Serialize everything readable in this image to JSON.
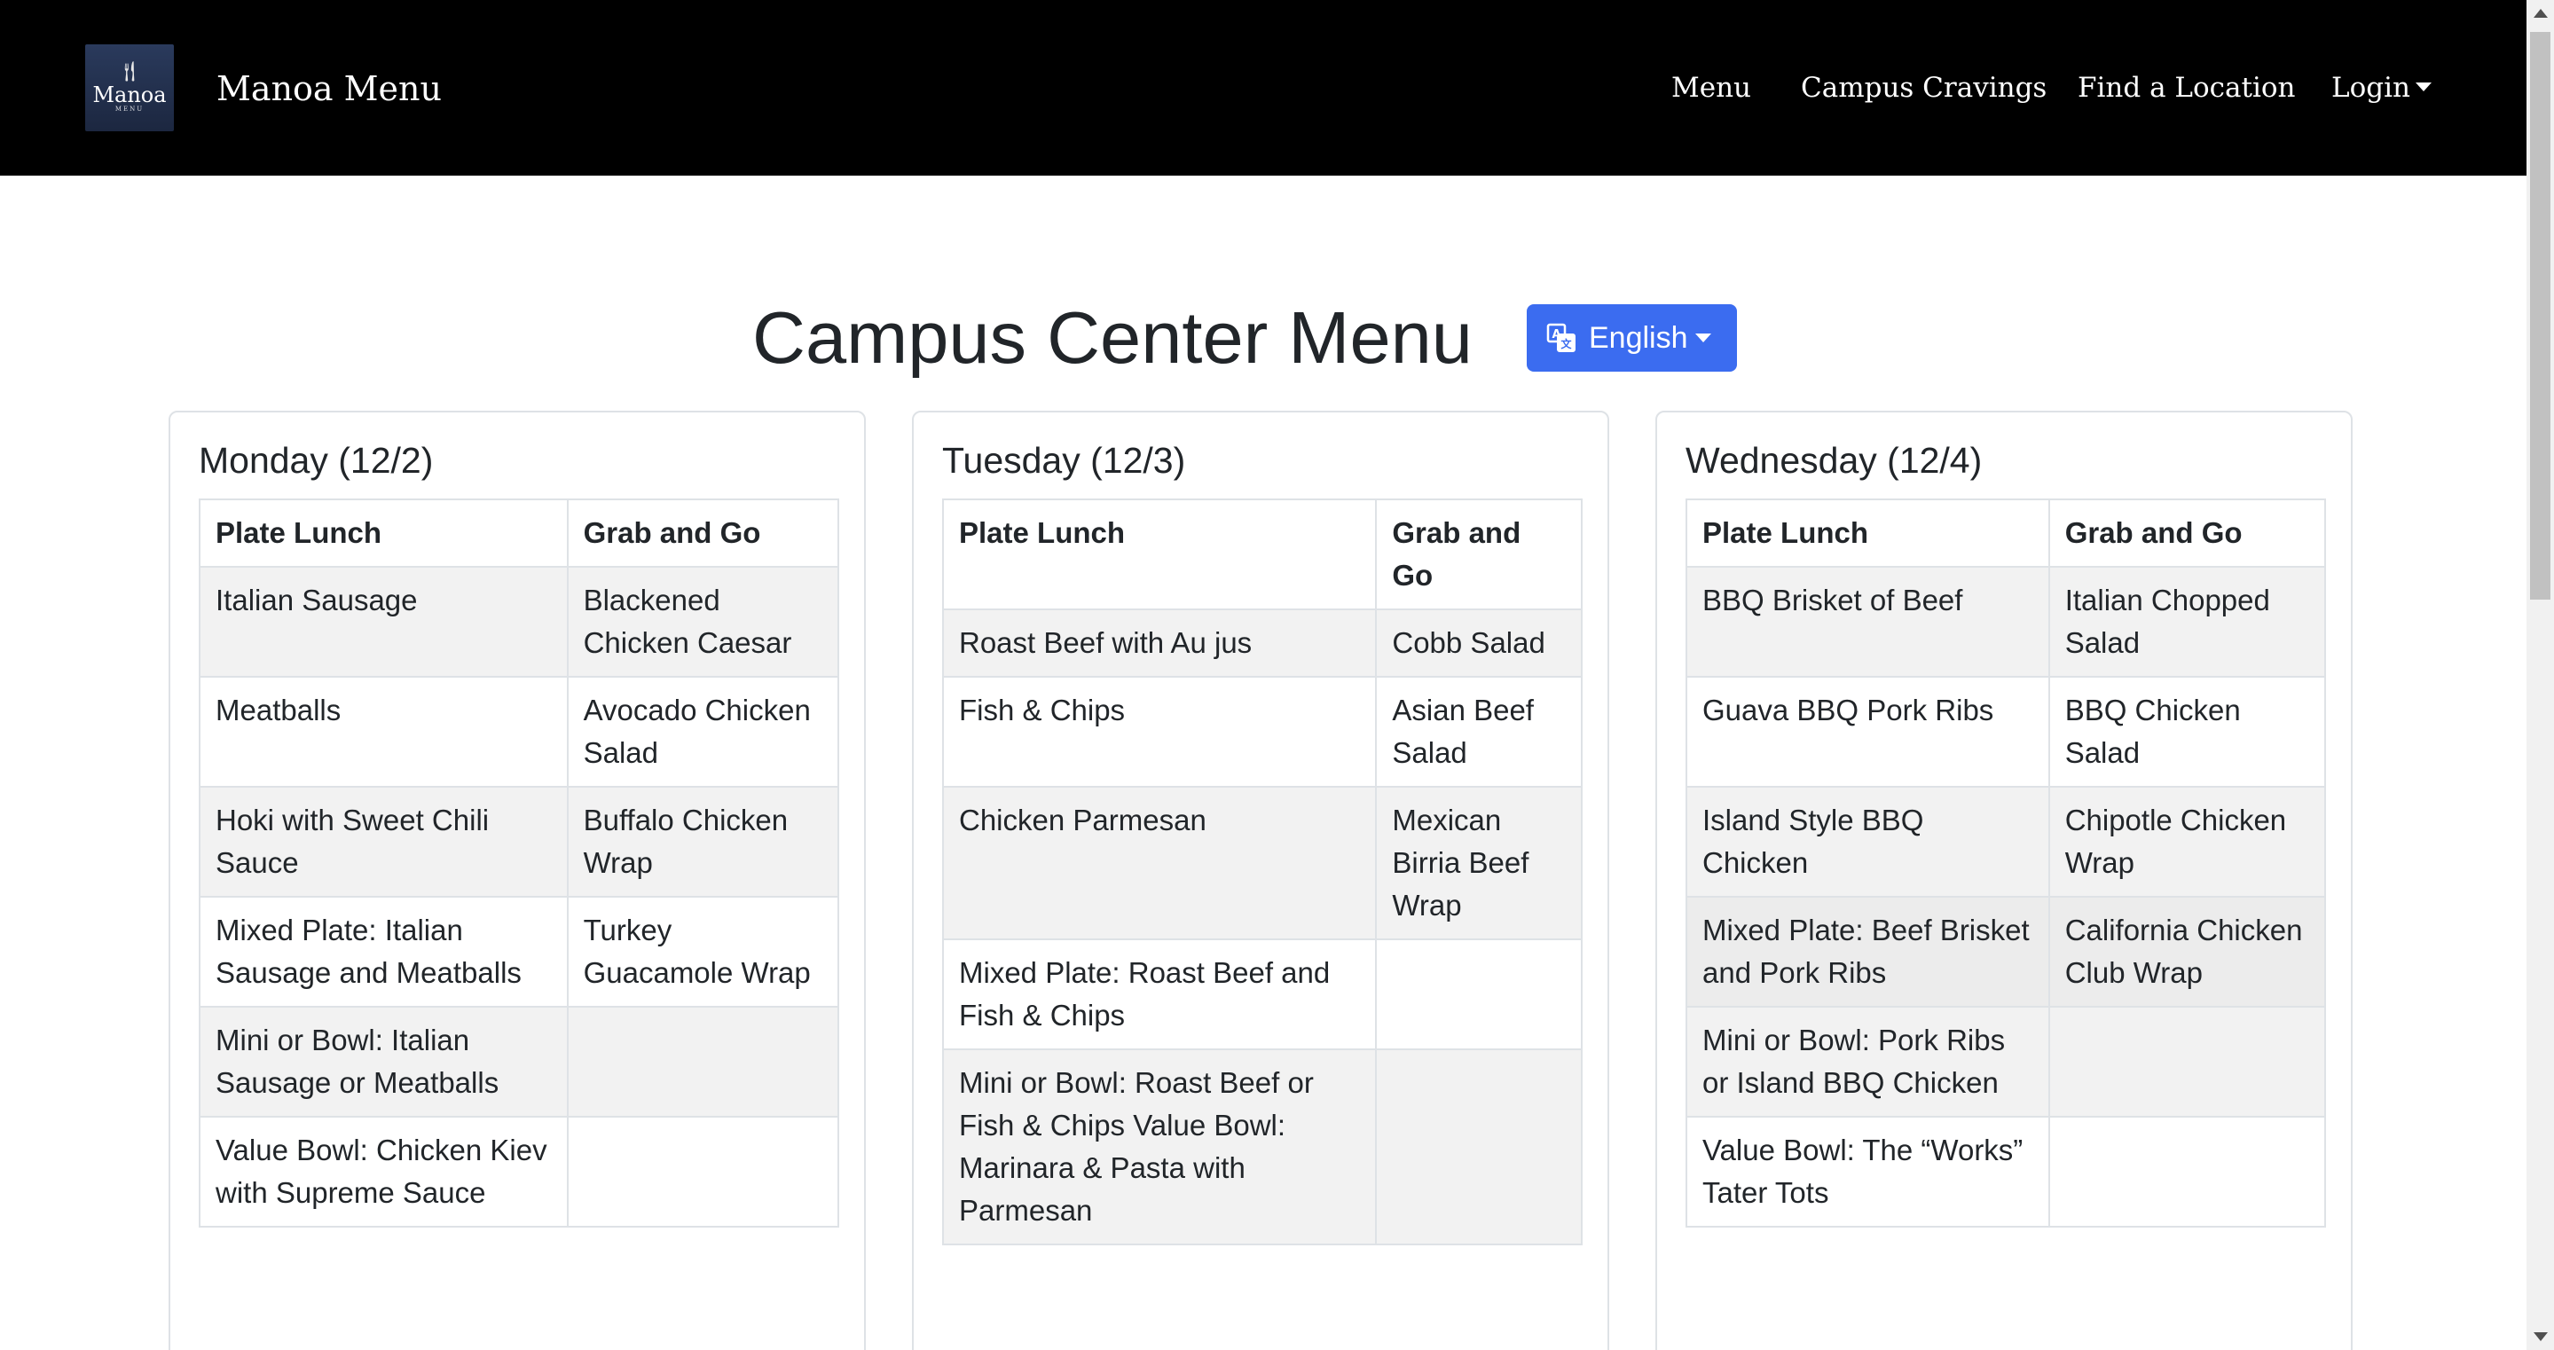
{
  "navbar": {
    "logo": {
      "word": "Manoa",
      "sub": "MENU"
    },
    "brand": "Manoa Menu",
    "links": [
      "Menu",
      "Campus Cravings",
      "Find a Location"
    ],
    "login": "Login"
  },
  "icons": {
    "logo": "fork-knife-icon",
    "language": "translate-icon",
    "dropdown": "caret-down-icon"
  },
  "colors": {
    "navbar_bg": "#000000",
    "accent": "#3b6cf0",
    "stripe": "#f2f2f2",
    "border": "#dee2e6"
  },
  "page": {
    "title": "Campus Center Menu",
    "language": "English"
  },
  "days": [
    {
      "title": "Monday (12/2)",
      "headers": [
        "Plate Lunch",
        "Grab and Go"
      ],
      "rows": [
        [
          "Italian Sausage",
          "Blackened Chicken Caesar"
        ],
        [
          "Meatballs",
          "Avocado Chicken Salad"
        ],
        [
          "Hoki with Sweet Chili Sauce",
          "Buffalo Chicken Wrap"
        ],
        [
          "Mixed Plate: Italian Sausage and Meatballs",
          "Turkey Guacamole Wrap"
        ],
        [
          "Mini or Bowl: Italian Sausage or Meatballs",
          ""
        ],
        [
          "Value Bowl: Chicken Kiev with Supreme Sauce",
          ""
        ]
      ]
    },
    {
      "title": "Tuesday (12/3)",
      "headers": [
        "Plate Lunch",
        "Grab and Go"
      ],
      "rows": [
        [
          "Roast Beef with Au jus",
          "Cobb Salad"
        ],
        [
          "Fish & Chips",
          "Asian Beef Salad"
        ],
        [
          "Chicken Parmesan",
          "Mexican Birria Beef Wrap"
        ],
        [
          "Mixed Plate: Roast Beef and Fish & Chips",
          ""
        ],
        [
          "Mini or Bowl: Roast Beef or Fish & Chips Value Bowl: Marinara & Pasta with Parmesan",
          ""
        ]
      ]
    },
    {
      "title": "Wednesday (12/4)",
      "headers": [
        "Plate Lunch",
        "Grab and Go"
      ],
      "rows": [
        [
          "BBQ Brisket of Beef",
          "Italian Chopped Salad"
        ],
        [
          "Guava BBQ Pork Ribs",
          "BBQ Chicken Salad"
        ],
        [
          "Island Style BBQ Chicken",
          "Chipotle Chicken Wrap"
        ],
        [
          "Mixed Plate: Beef Brisket and Pork Ribs",
          "California Chicken Club Wrap"
        ],
        [
          "Mini or Bowl: Pork Ribs or Island BBQ Chicken",
          ""
        ],
        [
          "Value Bowl: The “Works” Tater Tots",
          ""
        ]
      ]
    }
  ]
}
